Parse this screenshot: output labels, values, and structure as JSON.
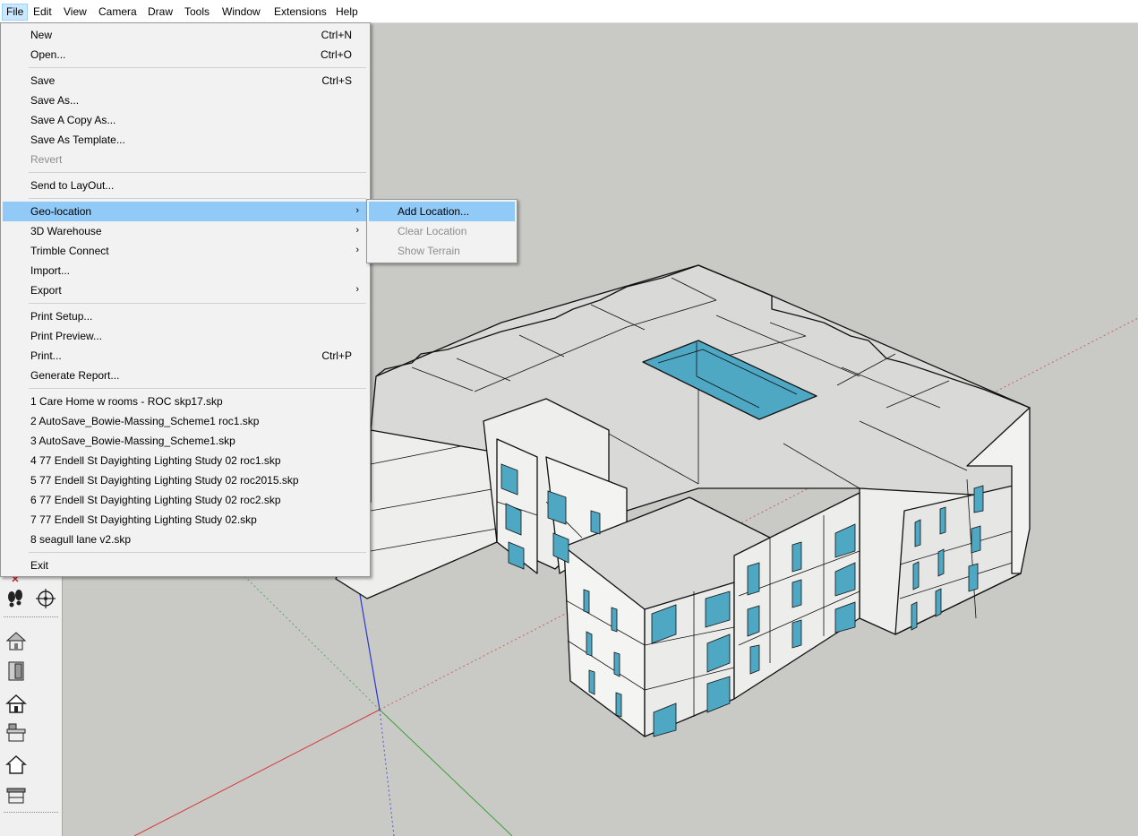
{
  "menubar": {
    "items": [
      {
        "label": "File"
      },
      {
        "label": "Edit"
      },
      {
        "label": "View"
      },
      {
        "label": "Camera"
      },
      {
        "label": "Draw"
      },
      {
        "label": "Tools"
      },
      {
        "label": "Window"
      },
      {
        "label": "Extensions"
      },
      {
        "label": "Help"
      }
    ]
  },
  "file_menu": {
    "new": {
      "label": "New",
      "shortcut": "Ctrl+N"
    },
    "open": {
      "label": "Open...",
      "shortcut": "Ctrl+O"
    },
    "save": {
      "label": "Save",
      "shortcut": "Ctrl+S"
    },
    "save_as": {
      "label": "Save As..."
    },
    "save_copy_as": {
      "label": "Save A Copy As..."
    },
    "save_as_template": {
      "label": "Save As Template..."
    },
    "revert": {
      "label": "Revert"
    },
    "send_to_layout": {
      "label": "Send to LayOut..."
    },
    "geo_location": {
      "label": "Geo-location"
    },
    "warehouse": {
      "label": "3D Warehouse"
    },
    "trimble_connect": {
      "label": "Trimble Connect"
    },
    "import": {
      "label": "Import..."
    },
    "export": {
      "label": "Export"
    },
    "print_setup": {
      "label": "Print Setup..."
    },
    "print_preview": {
      "label": "Print Preview..."
    },
    "print": {
      "label": "Print...",
      "shortcut": "Ctrl+P"
    },
    "generate_report": {
      "label": "Generate Report..."
    },
    "recent": [
      "1 Care Home w rooms - ROC skp17.skp",
      "2 AutoSave_Bowie-Massing_Scheme1 roc1.skp",
      "3 AutoSave_Bowie-Massing_Scheme1.skp",
      "4 77 Endell St Dayighting Lighting Study 02 roc1.skp",
      "5 77 Endell St Dayighting Lighting Study 02 roc2015.skp",
      "6 77 Endell St Dayighting Lighting Study 02 roc2.skp",
      "7 77 Endell St Dayighting Lighting Study 02.skp",
      "8 seagull lane v2.skp"
    ],
    "exit": {
      "label": "Exit"
    }
  },
  "geo_submenu": {
    "add_location": "Add Location...",
    "clear_location": "Clear Location",
    "show_terrain": "Show Terrain"
  },
  "toolbar": {
    "icons": [
      "eraser-icon",
      "footprints-icon",
      "position-camera-icon",
      "house-icon",
      "door-icon",
      "house-outline-icon",
      "shed-icon",
      "house-plain-icon",
      "bus-stop-icon"
    ]
  },
  "colors": {
    "menu_highlight": "#91c9f7",
    "menubar_active": "#cce8ff",
    "glass": "#4ea8c4",
    "ground": "#c9c9c5"
  }
}
